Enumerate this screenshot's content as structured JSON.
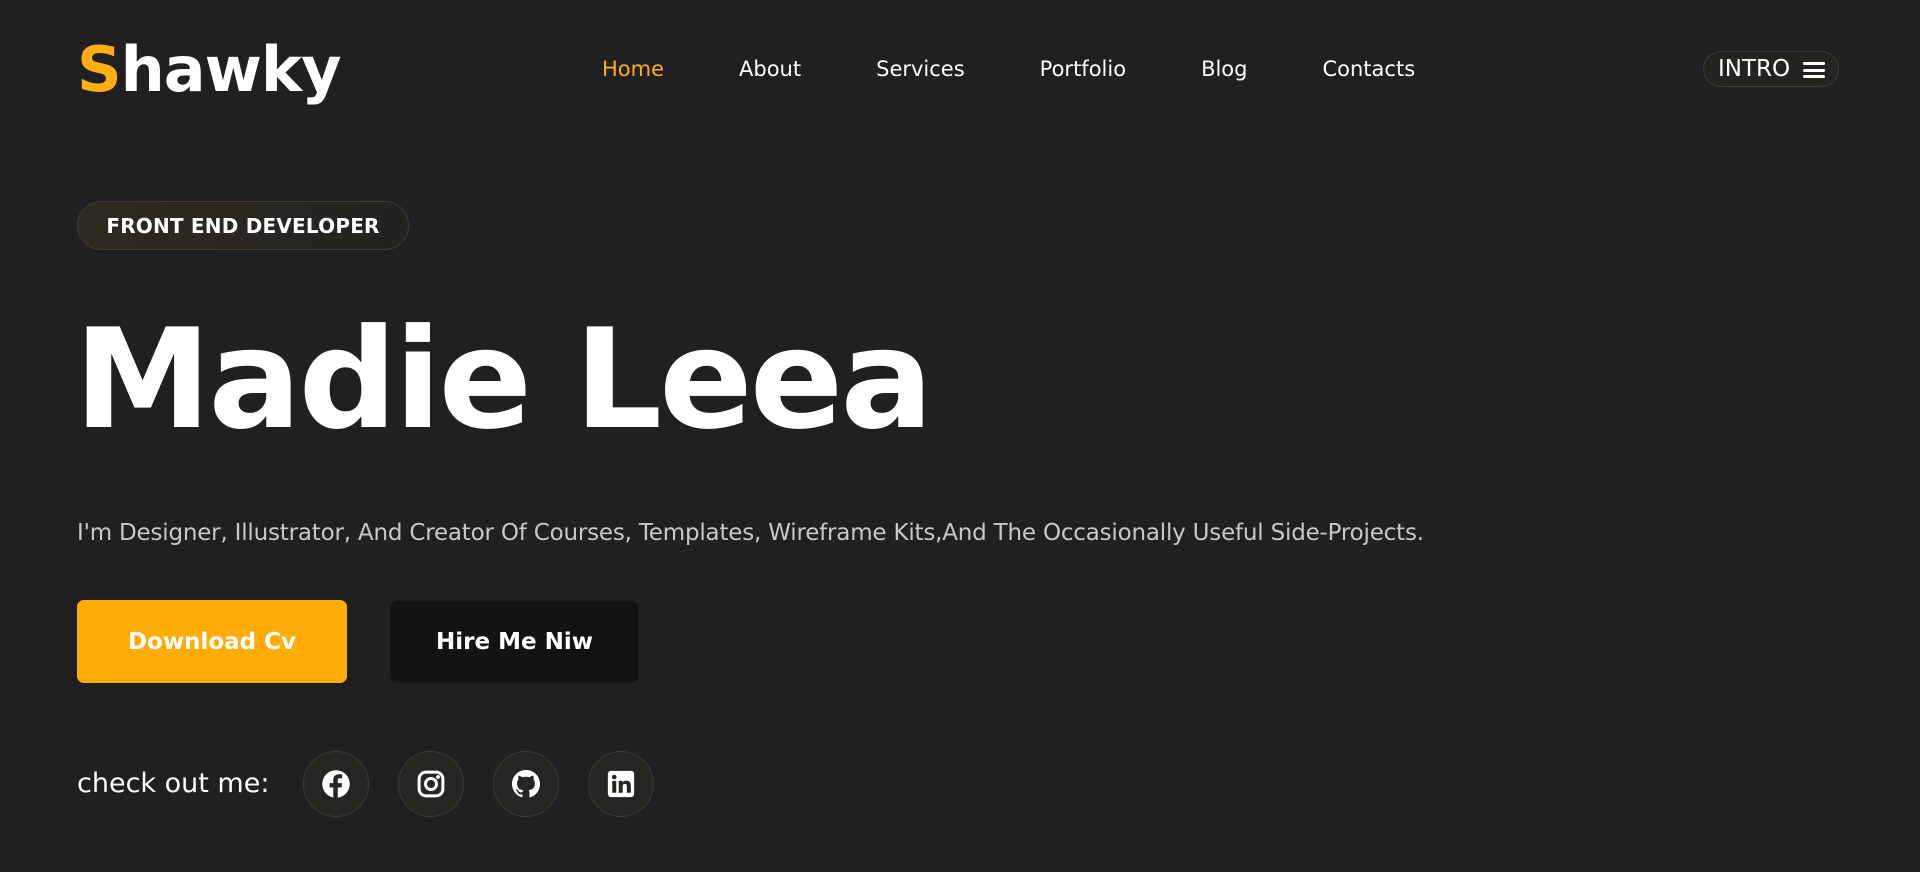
{
  "brand": {
    "initial": "S",
    "rest": "hawky",
    "accent_color": "#ffad14"
  },
  "nav": {
    "items": [
      {
        "label": "Home",
        "active": true
      },
      {
        "label": "About",
        "active": false
      },
      {
        "label": "Services",
        "active": false
      },
      {
        "label": "Portfolio",
        "active": false
      },
      {
        "label": "Blog",
        "active": false
      },
      {
        "label": "Contacts",
        "active": false
      }
    ]
  },
  "header": {
    "intro_label": "INTRO",
    "menu_icon": "hamburger-icon"
  },
  "hero": {
    "badge": "FRONT END DEVELOPER",
    "name": "Madie Leea",
    "tagline": "I'm Designer, Illustrator, And Creator Of Courses, Templates, Wireframe Kits,And The Occasionally Useful Side-Projects.",
    "primary_button": "Download Cv",
    "secondary_button": "Hire Me Niw"
  },
  "social": {
    "label": "check out me:",
    "links": [
      {
        "icon": "facebook-icon"
      },
      {
        "icon": "instagram-icon"
      },
      {
        "icon": "github-icon"
      },
      {
        "icon": "linkedin-icon"
      }
    ]
  },
  "colors": {
    "background": "#201f21",
    "accent": "#ffad05",
    "text": "#ffffff",
    "muted": "#c9c8c6"
  }
}
